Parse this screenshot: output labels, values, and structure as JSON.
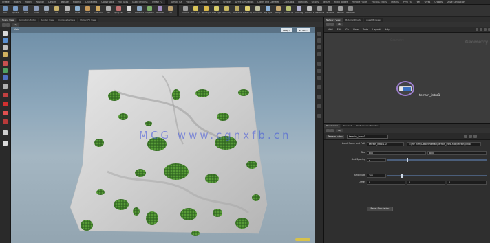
{
  "shelf": {
    "tabs": [
      "Create",
      "Modify",
      "Model",
      "Polygon",
      "Deform",
      "Texture",
      "Rigging",
      "Characters",
      "Constraints",
      "Hair Utils",
      "Guide Process",
      "Terrain FX",
      "Simple FX",
      "Volume",
      "TD Tools",
      "Vellum",
      "Crowds",
      "Drive Simulation",
      "Lights and Cameras",
      "Collisions",
      "Particles",
      "Grains",
      "Vellum",
      "Rigid Bodies",
      "Particle Fluids",
      "Viscous Fluids",
      "Oceans",
      "Pyro FX",
      "FEM",
      "Wires",
      "Crowds",
      "Drive Simulation"
    ],
    "left_tools": [
      {
        "label": "Box",
        "icon": "box-icon",
        "color": "#6f8fb5"
      },
      {
        "label": "Sphere",
        "icon": "sphere-icon",
        "color": "#7a9cc6"
      },
      {
        "label": "Tube",
        "icon": "tube-icon",
        "color": "#7a8fb0"
      },
      {
        "label": "Torus",
        "icon": "torus-icon",
        "color": "#8a9ab8"
      },
      {
        "label": "Grid",
        "icon": "grid-icon",
        "color": "#9aa7b8"
      },
      {
        "label": "Null",
        "icon": "null-icon",
        "color": "#c9b26a"
      },
      {
        "label": "Line",
        "icon": "line-icon",
        "color": "#b8b8b8"
      },
      {
        "label": "Circle",
        "icon": "circle-icon",
        "color": "#8cb0d0"
      },
      {
        "label": "Curve",
        "icon": "curve-icon",
        "color": "#c89a5a"
      },
      {
        "label": "Draw Curve",
        "icon": "draw-curve-icon",
        "color": "#d0a860"
      },
      {
        "label": "Path",
        "icon": "path-icon",
        "color": "#b0b0b0"
      },
      {
        "label": "Spray Paint",
        "icon": "spray-paint-icon",
        "color": "#c07070"
      },
      {
        "label": "Text",
        "icon": "text-icon",
        "color": "#d8d8d8"
      },
      {
        "label": "Platonic Solids",
        "icon": "platonic-icon",
        "color": "#8aa6c4"
      },
      {
        "label": "L-System",
        "icon": "lsystem-icon",
        "color": "#7cae6a"
      },
      {
        "label": "Metaball",
        "icon": "metaball-icon",
        "color": "#a08cc0"
      },
      {
        "label": "File",
        "icon": "file-icon",
        "color": "#b9a070"
      }
    ],
    "right_tools": [
      {
        "label": "Camera",
        "icon": "camera-icon",
        "color": "#9c9c9c"
      },
      {
        "label": "Point Light",
        "icon": "point-light-icon",
        "color": "#d8c45a"
      },
      {
        "label": "Spot Light",
        "icon": "spot-light-icon",
        "color": "#d8b84a"
      },
      {
        "label": "Area Light",
        "icon": "area-light-icon",
        "color": "#d8cc6a"
      },
      {
        "label": "Geometry Light",
        "icon": "geo-light-icon",
        "color": "#c8b860"
      },
      {
        "label": "Volume Light",
        "icon": "volume-light-icon",
        "color": "#b8a860"
      },
      {
        "label": "Distant Light",
        "icon": "distant-light-icon",
        "color": "#e0d070"
      },
      {
        "label": "Environment Light",
        "icon": "env-light-icon",
        "color": "#c0c0a0"
      },
      {
        "label": "Sky Light",
        "icon": "sky-light-icon",
        "color": "#8ab0d8"
      },
      {
        "label": "GI Light",
        "icon": "gi-light-icon",
        "color": "#c8a870"
      },
      {
        "label": "Caustic Light",
        "icon": "caustic-light-icon",
        "color": "#b8c070"
      },
      {
        "label": "Portal Light",
        "icon": "portal-light-icon",
        "color": "#b0b0d0"
      },
      {
        "label": "Ambient Light",
        "icon": "ambient-light-icon",
        "color": "#c0c0c0"
      },
      {
        "label": "Stereo Camera",
        "icon": "stereo-camera-icon",
        "color": "#9a9a9a"
      },
      {
        "label": "VR Camera",
        "icon": "vr-camera-icon",
        "color": "#909090"
      },
      {
        "label": "Switcher",
        "icon": "switcher-icon",
        "color": "#a0a0a0"
      },
      {
        "label": "Gamepad Camera",
        "icon": "gamepad-camera-icon",
        "color": "#8c8c8c"
      }
    ]
  },
  "viewport_pane": {
    "tabs": [
      "Scene View",
      "Animation Editor",
      "Render View",
      "Composite View",
      "Motion FX View"
    ],
    "active_tab": 0,
    "path": "obj",
    "viewport_name": "Main",
    "persp_button": "Persp ▾",
    "cam_button": "No cam ▾"
  },
  "watermark_text": "MCG www.cgnxfb.cn",
  "network_pane": {
    "tabs": [
      "Network View",
      "Material Palette",
      "Asset Browser"
    ],
    "active_tab": 0,
    "path": "obj",
    "menu": [
      "Add",
      "Edit",
      "Go",
      "View",
      "Tools",
      "Layout",
      "Help"
    ],
    "context_label": "Geometry",
    "object_label": "Geometry",
    "node_name": "terrain_intro1",
    "node_color": "#3a6fc0"
  },
  "param_pane": {
    "tabs": [
      "Parameters",
      "Take List",
      "Performance Monitor"
    ],
    "active_tab": 0,
    "path": "obj",
    "node_type": "Terrain Intro",
    "node_name": "terrain_intro1",
    "rows": [
      {
        "label": "Asset Name and Path",
        "values": [
          "terrain_intro 1.0",
          "E:/My Files/Catbird/terrain/terrain_intro.hda/Terrain_Intro"
        ]
      },
      {
        "label": "Size",
        "values": [
          "800",
          "800"
        ]
      },
      {
        "label": "Grid Spacing",
        "values": [
          "2"
        ]
      },
      {
        "label": "Amplitude",
        "values": [
          "300"
        ]
      },
      {
        "label": "Offset",
        "values": [
          "0",
          "0",
          "0"
        ]
      }
    ],
    "reset_button": "Reset Simulation"
  }
}
